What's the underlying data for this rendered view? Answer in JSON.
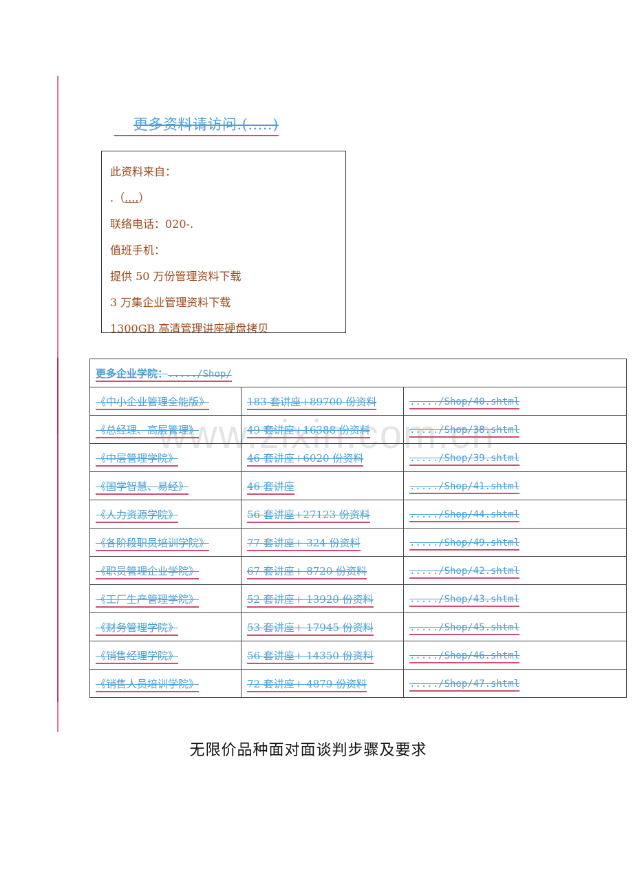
{
  "header": {
    "visit_link": "更多资料请访问.(.....)"
  },
  "info_box": {
    "lines": [
      "此资料来自：",
      ".（",
      "....",
      "）",
      "联络电话：020-.",
      "值班手机：",
      "提供 50 万份管理资料下载",
      "3 万集企业管理资料下载",
      "1300GB 高清管理讲座硬盘拷贝"
    ]
  },
  "watermark": "www.zixin.com.cn",
  "table": {
    "header_label": "更多企业学院：",
    "header_link": "...../Shop/",
    "rows": [
      {
        "name": "《中小企业管理全能版》",
        "content": "183 套讲座+89700 份资料",
        "url": "...../Shop/40.shtml"
      },
      {
        "name": "《总经理、高层管理》",
        "content": "49 套讲座+16388 份资料",
        "url": "...../Shop/38.shtml"
      },
      {
        "name": "《中层管理学院》",
        "content": "46 套讲座+6020 份资料",
        "url": "...../Shop/39.shtml"
      },
      {
        "name": "《国学智慧、易经》",
        "content": "46 套讲座",
        "url": "...../Shop/41.shtml"
      },
      {
        "name": "《人力资源学院》",
        "content": "56 套讲座+27123 份资料",
        "url": "...../Shop/44.shtml"
      },
      {
        "name": "《各阶段职员培训学院》",
        "content": "77 套讲座+ 324 份资料",
        "url": "...../Shop/49.shtml"
      },
      {
        "name": "《职员管理企业学院》",
        "content": "67 套讲座+ 8720 份资料",
        "url": "...../Shop/42.shtml"
      },
      {
        "name": "《工厂生产管理学院》",
        "content": "52 套讲座+ 13920 份资料",
        "url": "...../Shop/43.shtml"
      },
      {
        "name": "《财务管理学院》",
        "content": "53 套讲座+ 17945 份资料",
        "url": "...../Shop/45.shtml"
      },
      {
        "name": "《销售经理学院》",
        "content": "56 套讲座+ 14350 份资料",
        "url": "...../Shop/46.shtml"
      },
      {
        "name": "《销售人员培训学院》",
        "content": "72 套讲座+ 4879 份资料",
        "url": "...../Shop/47.shtml"
      }
    ]
  },
  "document": {
    "title": "无限价品种面对面谈判步骤及要求"
  }
}
